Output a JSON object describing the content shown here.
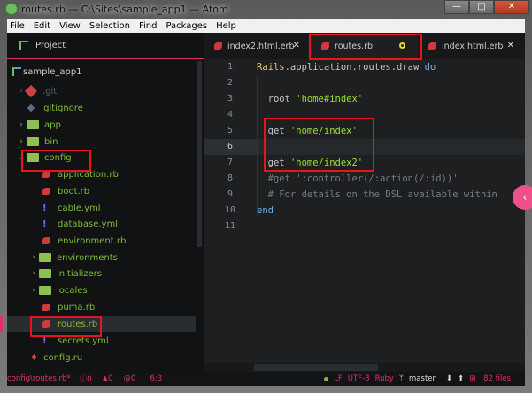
{
  "window": {
    "title": "routes.rb — C:\\Sites\\sample_app1 — Atom",
    "minimize": "—",
    "maximize": "□",
    "close": "✕"
  },
  "menu": [
    "File",
    "Edit",
    "View",
    "Selection",
    "Find",
    "Packages",
    "Help"
  ],
  "sidebar": {
    "header": "Project",
    "root": "sample_app1",
    "items": [
      ".git",
      ".gitignore",
      "app",
      "bin",
      "config",
      "application.rb",
      "boot.rb",
      "cable.yml",
      "database.yml",
      "environment.rb",
      "environments",
      "initializers",
      "locales",
      "puma.rb",
      "routes.rb",
      "secrets.yml",
      "config.ru"
    ]
  },
  "tabs": [
    {
      "label": "index2.html.erb",
      "close": "✕"
    },
    {
      "label": "routes.rb"
    },
    {
      "label": "index.html.erb",
      "close": "✕"
    }
  ],
  "editor": {
    "line_numbers": [
      "1",
      "2",
      "3",
      "4",
      "5",
      "6",
      "7",
      "8",
      "9",
      "10",
      "11"
    ],
    "current_line": 6,
    "lines": {
      "l1a": "Rails",
      "l1b": ".application.routes.draw ",
      "l1c": "do",
      "l3a": "  root ",
      "l3b": "'home#index'",
      "l5a": "  get ",
      "l5b": "'home/index'",
      "l7a": "  get ",
      "l7b": "'home/index2'",
      "l8": "  #get ':controller(/:action(/:id))'",
      "l9": "  # For details on the DSL available within",
      "l10": "end"
    }
  },
  "status": {
    "path": "config\\routes.rb*",
    "errors": "0",
    "warnings": "0",
    "info": "0",
    "cursor": "6:3",
    "eol": "LF",
    "encoding": "UTF-8",
    "grammar": "Ruby",
    "branch": "master",
    "files": "82 files"
  },
  "colors": {
    "accent": "#e0306c",
    "highlight_box": "#e8141d",
    "string": "#9fe02d"
  }
}
